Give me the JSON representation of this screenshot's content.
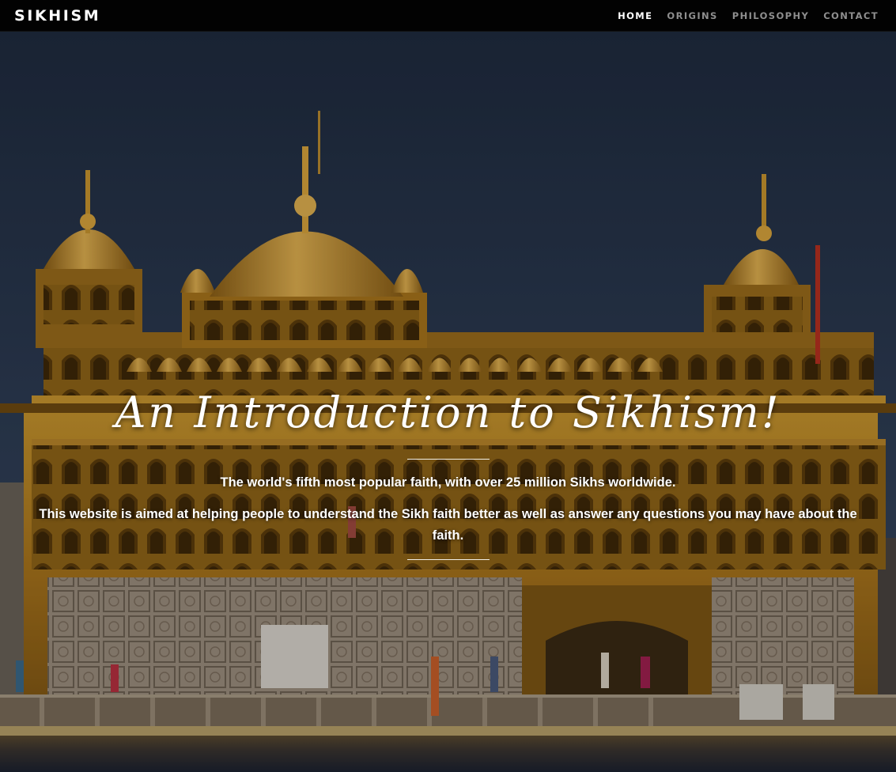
{
  "navbar": {
    "brand": "SIKHISM",
    "links": [
      {
        "label": "HOME",
        "active": true
      },
      {
        "label": "ORIGINS",
        "active": false
      },
      {
        "label": "PHILOSOPHY",
        "active": false
      },
      {
        "label": "CONTACT",
        "active": false
      }
    ]
  },
  "hero": {
    "title": "An Introduction to Sikhism!",
    "subtitle": "The world's fifth most popular faith, with over 25 million Sikhs worldwide.",
    "description": "This website is aimed at helping people to understand the Sikh faith better as well as answer any questions you may have about the faith.",
    "background_image": "golden-temple-photo"
  },
  "colors": {
    "navbar_bg": "#020202",
    "nav_active": "#ffffff",
    "nav_inactive": "#8e8e8e",
    "gold": "#b8862a",
    "sky": "#273447"
  }
}
